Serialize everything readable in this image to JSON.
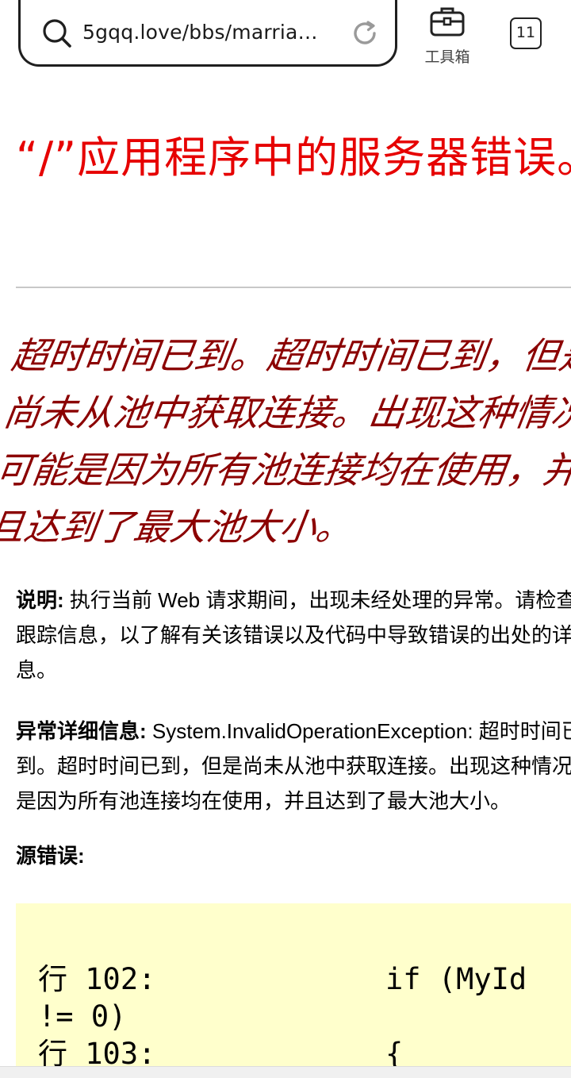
{
  "browser": {
    "url": "5gqq.love/bbs/marriag...",
    "toolbox_label": "工具箱",
    "tab_count": "11"
  },
  "page": {
    "title": "“/”应用程序中的服务器错误。",
    "error_message": "超时时间已到。超时时间已到，但是尚未从池中获取连接。出现这种情况可能是因为所有池连接均在使用，并且达到了最大池大小。",
    "description_label": "说明:",
    "description_text": " 执行当前 Web 请求期间，出现未经处理的异常。请检查堆栈跟踪信息，以了解有关该错误以及代码中导致错误的出处的详细信息。",
    "exception_label": "异常详细信息:",
    "exception_text": " System.InvalidOperationException: 超时时间已到。超时时间已到，但是尚未从池中获取连接。出现这种情况可能是因为所有池连接均在使用，并且达到了最大池大小。",
    "source_error_label": "源错误:",
    "code": "行 102:             if (MyId\n!= 0)\n行 103:             {"
  },
  "colors": {
    "title": "#e60000",
    "message": "#8b0000",
    "code_background": "#ffffcc"
  }
}
